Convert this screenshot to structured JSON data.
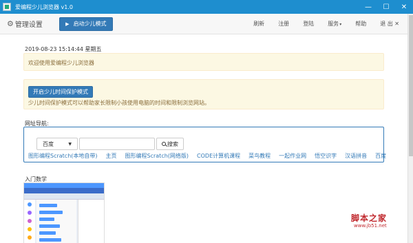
{
  "window": {
    "title": "爱编程少儿浏览器 v1.0",
    "controls": [
      "—",
      "☐",
      "✕"
    ]
  },
  "navbar": {
    "brand": "管理设置",
    "kids_mode_button": "启动少儿模式",
    "links": {
      "refresh": "刷新",
      "register": "注册",
      "login": "登陆",
      "service": "服务",
      "help": "帮助",
      "exit": "退 出"
    }
  },
  "main": {
    "datetime": "2019-08-23 15:14:44 星期五",
    "welcome": "欢迎使用爱编程少儿浏览器",
    "protect_button": "开启少儿时间保护模式",
    "protect_desc": "少儿时间保护模式可以帮助家长限制小孩使用电脑的时间和限制浏览网站。",
    "nav_label": "网址导航:",
    "search": {
      "engine": "百度",
      "button": "搜索",
      "value": ""
    },
    "links": [
      "图形编程Scratch(本地自带)",
      "主页",
      "图形编程Scratch(网络版)",
      "CODE计算机课程",
      "菜鸟教程",
      "一起作业网",
      "悟空识字",
      "汉语拼音",
      "百度"
    ],
    "intro_label": "入门数学"
  },
  "watermark": {
    "text": "脚本之家",
    "url": "www.jb51.net"
  }
}
